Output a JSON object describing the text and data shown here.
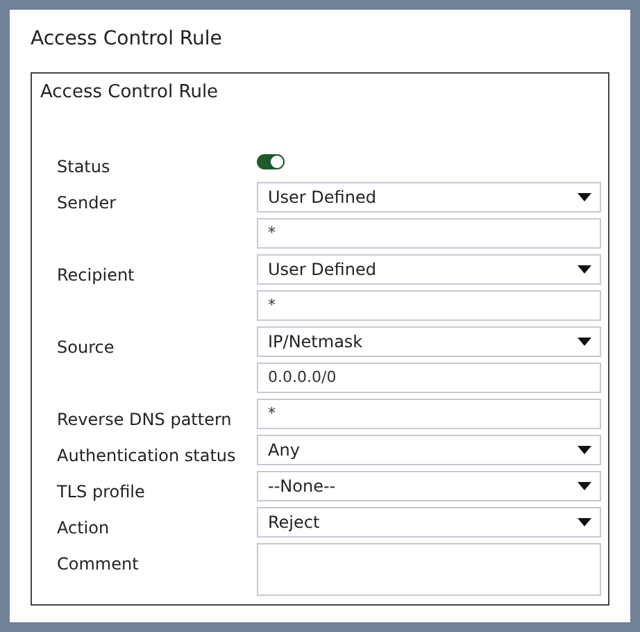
{
  "window": {
    "title": "Access Control Rule"
  },
  "panel": {
    "title": "Access Control Rule"
  },
  "rows": [
    {
      "kind": "toggle",
      "label": "Status",
      "on": true
    },
    {
      "kind": "select",
      "label": "Sender",
      "value": "User Defined"
    },
    {
      "kind": "text",
      "value": "*"
    },
    {
      "kind": "select",
      "label": "Recipient",
      "value": "User Defined"
    },
    {
      "kind": "text",
      "value": "*"
    },
    {
      "kind": "select",
      "label": "Source",
      "value": "IP/Netmask"
    },
    {
      "kind": "text",
      "value": "0.0.0.0/0"
    },
    {
      "kind": "text",
      "label": "Reverse DNS pattern",
      "value": "*"
    },
    {
      "kind": "select",
      "label": "Authentication status",
      "value": "Any"
    },
    {
      "kind": "select",
      "label": "TLS profile",
      "value": "--None--"
    },
    {
      "kind": "select",
      "label": "Action",
      "value": "Reject"
    },
    {
      "kind": "textarea",
      "label": "Comment"
    }
  ]
}
